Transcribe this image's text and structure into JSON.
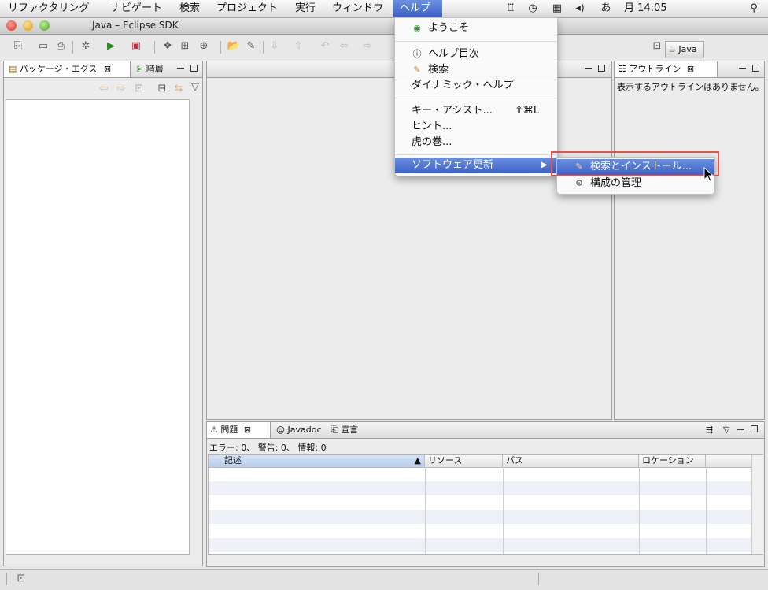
{
  "menubar": {
    "items": [
      "リファクタリング",
      "ナビゲート",
      "検索",
      "プロジェクト",
      "実行",
      "ウィンドウ",
      "ヘルプ"
    ],
    "active_index": 6,
    "clock": "月 14:05"
  },
  "window": {
    "title": "Java – Eclipse SDK"
  },
  "perspective": {
    "label": "Java"
  },
  "left_panel": {
    "tabs": [
      "パッケージ・エクス",
      "階層"
    ]
  },
  "outline_panel": {
    "tab": "アウトライン",
    "message": "表示するアウトラインはありません。"
  },
  "bottom_panel": {
    "tabs": [
      "問題",
      "Javadoc",
      "宣言"
    ],
    "summary": "エラー: 0、 警告: 0、 情報: 0",
    "columns": [
      "記述",
      "リソース",
      "パス",
      "ロケーション"
    ]
  },
  "help_menu": {
    "items": [
      {
        "label": "ようこそ",
        "icon": "welcome-icon"
      },
      {
        "label": "ヘルプ目次",
        "icon": "help-icon"
      },
      {
        "label": "検索",
        "icon": "search-icon"
      },
      {
        "label": "ダイナミック・ヘルプ",
        "icon": ""
      },
      {
        "label": "キー・アシスト...",
        "shortcut": "⇧⌘L"
      },
      {
        "label": "ヒント..."
      },
      {
        "label": "虎の巻..."
      },
      {
        "label": "ソフトウェア更新",
        "icon": "submenu-arrow-icon"
      }
    ]
  },
  "submenu": {
    "items": [
      {
        "label": "検索とインストール...",
        "icon": "install-icon"
      },
      {
        "label": "構成の管理",
        "icon": "config-icon"
      }
    ]
  },
  "colors": {
    "highlight": "#3d62c7",
    "annotation": "#e8504a"
  }
}
